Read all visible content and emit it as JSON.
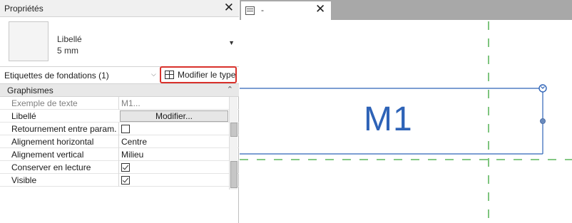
{
  "properties": {
    "title": "Propriétés",
    "close_glyph": "✕",
    "type_name": "Libellé",
    "type_size": "5 mm",
    "type_dropdown_glyph": "▼",
    "selector_label": "Etiquettes de fondations (1)",
    "selector_arrow": "⌵",
    "edit_type_label": "Modifier le type",
    "edit_type_icon": "edit-type-icon",
    "group_label": "Graphismes",
    "group_collapse_glyph": "⌃",
    "rows": [
      {
        "label": "Exemple de texte",
        "value": "M1...",
        "kind": "text",
        "dim": true
      },
      {
        "label": "Libellé",
        "value": "Modifier...",
        "kind": "button",
        "dim": false
      },
      {
        "label": "Retournement entre param...",
        "value": "",
        "kind": "checkbox",
        "checked": false,
        "dim": false
      },
      {
        "label": "Alignement horizontal",
        "value": "Centre",
        "kind": "text",
        "dim": false
      },
      {
        "label": "Alignement vertical",
        "value": "Milieu",
        "kind": "text",
        "dim": false
      },
      {
        "label": "Conserver en lecture",
        "value": "",
        "kind": "checkbox",
        "checked": true,
        "dim": false
      },
      {
        "label": "Visible",
        "value": "",
        "kind": "checkbox",
        "checked": true,
        "dim": false
      }
    ]
  },
  "view": {
    "tab_title": "-",
    "tab_close_glyph": "✕",
    "tab_icon": "view-icon",
    "tag_text": "M1",
    "colors": {
      "tag_text": "#2e63b7",
      "tag_frame": "#2e63b7",
      "grid_line": "#3aa63a",
      "highlight": "#d9312b",
      "tab_bar": "#a8a8a8"
    }
  }
}
